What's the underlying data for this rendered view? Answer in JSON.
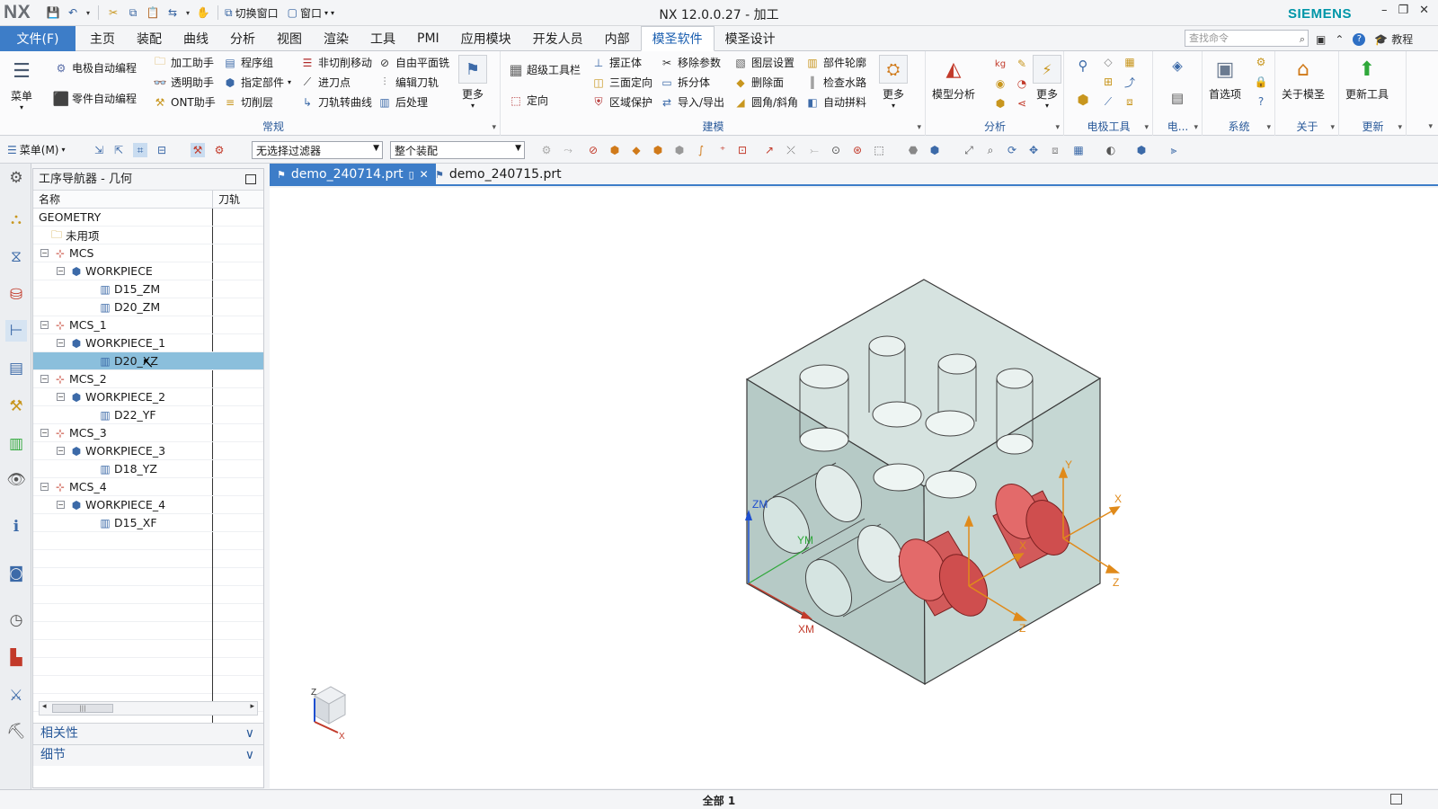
{
  "app": {
    "logo": "NX",
    "title": "NX 12.0.0.27 - 加工",
    "brand": "SIEMENS",
    "switch_window": "切换窗口",
    "window_menu": "窗口"
  },
  "menu": {
    "file": "文件(F)",
    "tabs": [
      "主页",
      "装配",
      "曲线",
      "分析",
      "视图",
      "渲染",
      "工具",
      "PMI",
      "应用模块",
      "开发人员",
      "内部",
      "模圣软件",
      "模圣设计"
    ],
    "active_tab": "模圣软件",
    "search_placeholder": "查找命令",
    "tutorial": "教程"
  },
  "ribbon": {
    "menu_label": "菜单",
    "group_changgui": {
      "label": "常规",
      "buttons": [
        "电极自动编程",
        "零件自动编程",
        "加工助手",
        "透明助手",
        "ONT助手",
        "程序组",
        "指定部件",
        "切削层",
        "非切削移动",
        "进刀点",
        "刀轨转曲线",
        "自由平面铣",
        "编辑刀轨",
        "后处理",
        "更多"
      ]
    },
    "group_jianmo": {
      "label": "建模",
      "buttons": [
        "超级工具栏",
        "定向",
        "摆正体",
        "三面定向",
        "区域保护",
        "移除参数",
        "拆分体",
        "导入/导出",
        "图层设置",
        "删除面",
        "圆角/斜角",
        "部件轮廓",
        "检查水路",
        "自动拼料",
        "更多"
      ]
    },
    "group_fenxi": {
      "label": "分析",
      "buttons": [
        "模型分析",
        "更多"
      ]
    },
    "group_dianji": {
      "label": "电极工具"
    },
    "group_dian": {
      "label": "电..."
    },
    "group_xitong": {
      "label": "系统",
      "buttons": [
        "首选项"
      ]
    },
    "group_guanyu": {
      "label": "关于",
      "buttons": [
        "关于模圣"
      ]
    },
    "group_gengxin": {
      "label": "更新",
      "buttons": [
        "更新工具"
      ]
    }
  },
  "toolbar2": {
    "menu": "菜单(M)",
    "filter": "无选择过滤器",
    "scope": "整个装配"
  },
  "navigator": {
    "title": "工序导航器 - 几何",
    "col_name": "名称",
    "col_path": "刀轨",
    "rows": [
      {
        "label": "GEOMETRY",
        "level": 0,
        "type": "root"
      },
      {
        "label": "未用项",
        "level": 1,
        "type": "folder"
      },
      {
        "label": "MCS",
        "level": 1,
        "type": "mcs"
      },
      {
        "label": "WORKPIECE",
        "level": 2,
        "type": "workpiece"
      },
      {
        "label": "D15_ZM",
        "level": 3,
        "type": "op"
      },
      {
        "label": "D20_ZM",
        "level": 3,
        "type": "op"
      },
      {
        "label": "MCS_1",
        "level": 1,
        "type": "mcs"
      },
      {
        "label": "WORKPIECE_1",
        "level": 2,
        "type": "workpiece"
      },
      {
        "label": "D20_XZ",
        "level": 3,
        "type": "op",
        "selected": true
      },
      {
        "label": "MCS_2",
        "level": 1,
        "type": "mcs"
      },
      {
        "label": "WORKPIECE_2",
        "level": 2,
        "type": "workpiece"
      },
      {
        "label": "D22_YF",
        "level": 3,
        "type": "op"
      },
      {
        "label": "MCS_3",
        "level": 1,
        "type": "mcs"
      },
      {
        "label": "WORKPIECE_3",
        "level": 2,
        "type": "workpiece"
      },
      {
        "label": "D18_YZ",
        "level": 3,
        "type": "op"
      },
      {
        "label": "MCS_4",
        "level": 1,
        "type": "mcs"
      },
      {
        "label": "WORKPIECE_4",
        "level": 2,
        "type": "workpiece"
      },
      {
        "label": "D15_XF",
        "level": 3,
        "type": "op"
      }
    ],
    "panel_dependencies": "相关性",
    "panel_details": "细节"
  },
  "docs": {
    "tab1": "demo_240714.prt",
    "tab2": "demo_240715.prt"
  },
  "viewport": {
    "labels": {
      "zm": "ZM",
      "ym": "YM",
      "xm": "XM",
      "x1": "X",
      "z1": "Z",
      "y1": "Y",
      "x2": "X",
      "z2": "Z"
    },
    "triad": {
      "z": "Z",
      "x": "X"
    }
  },
  "status": {
    "text": "全部 1"
  },
  "colors": {
    "accent": "#3d7dc8",
    "selection": "#8bbfdc",
    "part_body": "#bcd0cc",
    "highlight_cylinder": "#e05a5a",
    "brand": "#0096a8"
  }
}
